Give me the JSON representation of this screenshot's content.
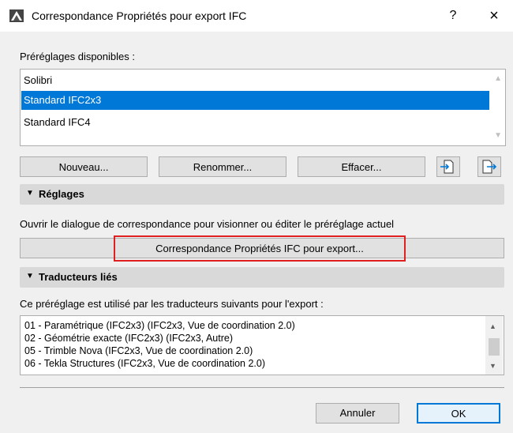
{
  "window": {
    "title": "Correspondance Propriétés pour export IFC",
    "help": "?",
    "close": "×"
  },
  "presets": {
    "label": "Préréglages disponibles :",
    "items": [
      "Solibri",
      "Standard IFC2x3",
      "Standard IFC4"
    ],
    "selected_index": 1
  },
  "buttons": {
    "new": "Nouveau...",
    "rename": "Renommer...",
    "delete": "Effacer..."
  },
  "settings": {
    "title": "Réglages",
    "description": "Ouvrir le dialogue de correspondance pour visionner ou éditer le préréglage actuel",
    "mapping_button": "Correspondance Propriétés IFC pour export..."
  },
  "translators": {
    "title": "Traducteurs liés",
    "description": "Ce préréglage est utilisé par les traducteurs suivants pour l'export :",
    "items": [
      "01 - Paramétrique (IFC2x3) (IFC2x3, Vue de coordination 2.0)",
      "02 - Géométrie exacte (IFC2x3) (IFC2x3, Autre)",
      "05 - Trimble Nova (IFC2x3, Vue de coordination 2.0)",
      "06 - Tekla Structures (IFC2x3, Vue de coordination 2.0)"
    ]
  },
  "footer": {
    "cancel": "Annuler",
    "ok": "OK"
  },
  "colors": {
    "selection": "#0078d7",
    "highlight_border": "#e02020"
  }
}
